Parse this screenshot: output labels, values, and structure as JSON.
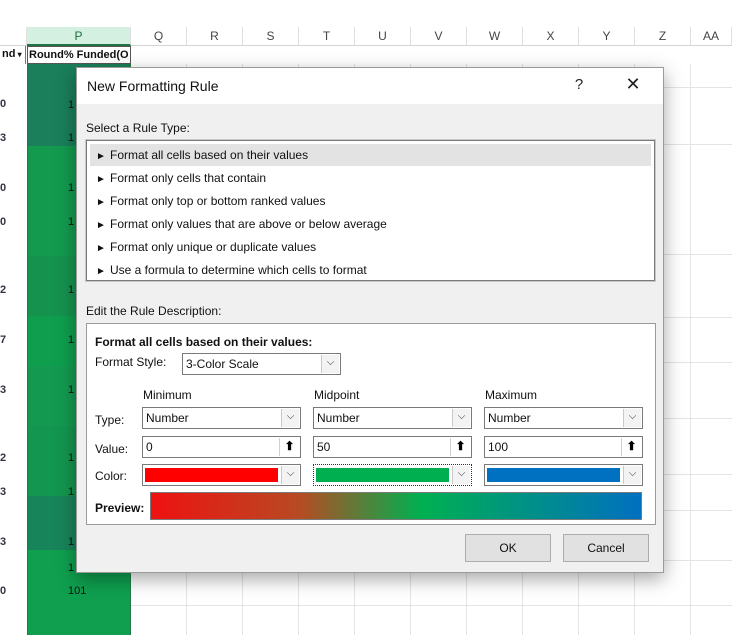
{
  "spreadsheet": {
    "columns": [
      "P",
      "Q",
      "R",
      "S",
      "T",
      "U",
      "V",
      "W",
      "X",
      "Y",
      "Z",
      "AA"
    ],
    "left_header_fragment": "nd",
    "p_header": "Round% Funded(O",
    "row_markers": [
      "0",
      "3",
      "0",
      "0",
      "2",
      "7",
      "3",
      "2",
      "3",
      "3",
      "0"
    ],
    "p_values": [
      "1",
      "1",
      "1",
      "1",
      "1",
      "1",
      "1",
      "1",
      "1",
      "1",
      "1",
      "101"
    ]
  },
  "dialog": {
    "title": "New Formatting Rule",
    "help_glyph": "?",
    "close_glyph": "✕",
    "select_label": "Select a Rule Type:",
    "rule_types": [
      "Format all cells based on their values",
      "Format only cells that contain",
      "Format only top or bottom ranked values",
      "Format only values that are above or below average",
      "Format only unique or duplicate values",
      "Use a formula to determine which cells to format"
    ],
    "edit_label": "Edit the Rule Description:",
    "desc_heading": "Format all cells based on their values:",
    "format_style_label": "Format Style:",
    "format_style_value": "3-Color Scale",
    "minimum_label": "Minimum",
    "midpoint_label": "Midpoint",
    "maximum_label": "Maximum",
    "type_label": "Type:",
    "value_label": "Value:",
    "color_label": "Color:",
    "min_type": "Number",
    "mid_type": "Number",
    "max_type": "Number",
    "min_value": "0",
    "mid_value": "50",
    "max_value": "100",
    "min_color": "#ff0000",
    "mid_color": "#00b050",
    "max_color": "#0070c0",
    "preview_label": "Preview:",
    "ok_label": "OK",
    "cancel_label": "Cancel"
  }
}
